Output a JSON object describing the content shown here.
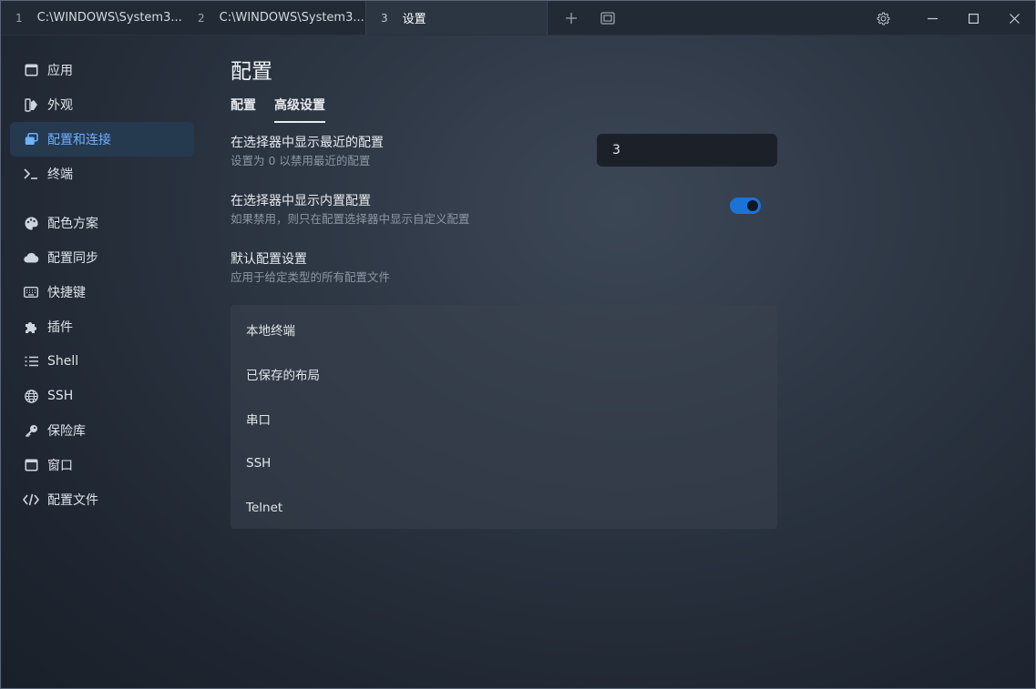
{
  "tabs": [
    {
      "num": "1",
      "label": "C:\\WINDOWS\\System3..."
    },
    {
      "num": "2",
      "label": "C:\\WINDOWS\\System3..."
    },
    {
      "num": "3",
      "label": "设置"
    }
  ],
  "sidebar": {
    "items": [
      {
        "label": "应用",
        "icon": "window-icon"
      },
      {
        "label": "外观",
        "icon": "palette-brush-icon"
      },
      {
        "label": "配置和连接",
        "icon": "windows-stack-icon",
        "active": true
      },
      {
        "label": "终端",
        "icon": "terminal-prompt-icon"
      },
      {
        "label": "配色方案",
        "icon": "palette-icon"
      },
      {
        "label": "配置同步",
        "icon": "cloud-icon"
      },
      {
        "label": "快捷键",
        "icon": "keyboard-icon"
      },
      {
        "label": "插件",
        "icon": "puzzle-icon"
      },
      {
        "label": "Shell",
        "icon": "list-icon"
      },
      {
        "label": "SSH",
        "icon": "globe-icon"
      },
      {
        "label": "保险库",
        "icon": "key-icon"
      },
      {
        "label": "窗口",
        "icon": "window-icon"
      },
      {
        "label": "配置文件",
        "icon": "code-icon"
      }
    ]
  },
  "main": {
    "title": "配置",
    "subtabs": [
      "配置",
      "高级设置"
    ],
    "settings": {
      "recent": {
        "label": "在选择器中显示最近的配置",
        "desc": "设置为 0 以禁用最近的配置",
        "value": "3"
      },
      "builtin": {
        "label": "在选择器中显示内置配置",
        "desc": "如果禁用，则只在配置选择器中显示自定义配置",
        "enabled": true
      },
      "defaults": {
        "label": "默认配置设置",
        "desc": "应用于给定类型的所有配置文件"
      }
    },
    "profile_types": [
      "本地终端",
      "已保存的布局",
      "串口",
      "SSH",
      "Telnet"
    ]
  },
  "colors": {
    "accent": "#6fb2ff",
    "toggle": "#1a73d9",
    "active_nav_bg": "#25394f"
  }
}
